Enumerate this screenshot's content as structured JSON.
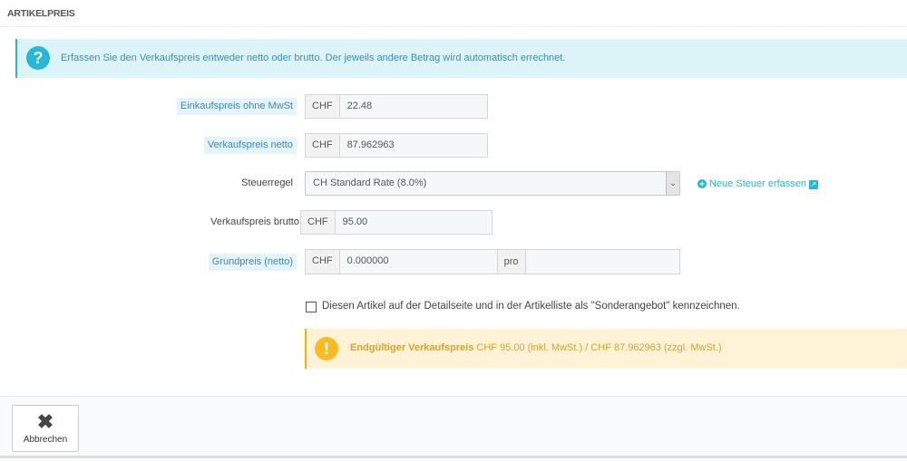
{
  "section_title": "ARTIKELPREIS",
  "info_text": "Erfassen Sie den Verkaufspreis entweder netto oder brutto. Der jeweils andere Betrag wird automatisch errechnet.",
  "icons": {
    "info": "?",
    "warning": "!",
    "cancel": "✖",
    "plus": "+",
    "external": "↗",
    "chevron": "⌄"
  },
  "fields": {
    "purchase": {
      "label": "Einkaufspreis ohne MwSt",
      "currency": "CHF",
      "value": "22.48"
    },
    "net": {
      "label": "Verkaufspreis netto",
      "currency": "CHF",
      "value": "87.962963"
    },
    "tax": {
      "label": "Steuerregel",
      "value": "CH Standard Rate (8.0%)",
      "link": "Neue Steuer erfassen"
    },
    "gross": {
      "label": "Verkaufspreis brutto",
      "currency": "CHF",
      "value": "95.00"
    },
    "unit": {
      "label": "Grundpreis (netto)",
      "currency": "CHF",
      "value": "0.000000",
      "per": "pro",
      "unit_value": ""
    }
  },
  "special_offer": {
    "label": "Diesen Artikel auf der Detailseite und in der Artikelliste als \"Sonderangebot\" kennzeichnen.",
    "checked": false
  },
  "final_price": {
    "label": "Endgültiger Verkaufspreis",
    "text": "CHF 95.00 (inkl. MwSt.) / CHF 87.962963 (zzgl. MwSt.)"
  },
  "footer": {
    "cancel": "Abbrechen"
  }
}
